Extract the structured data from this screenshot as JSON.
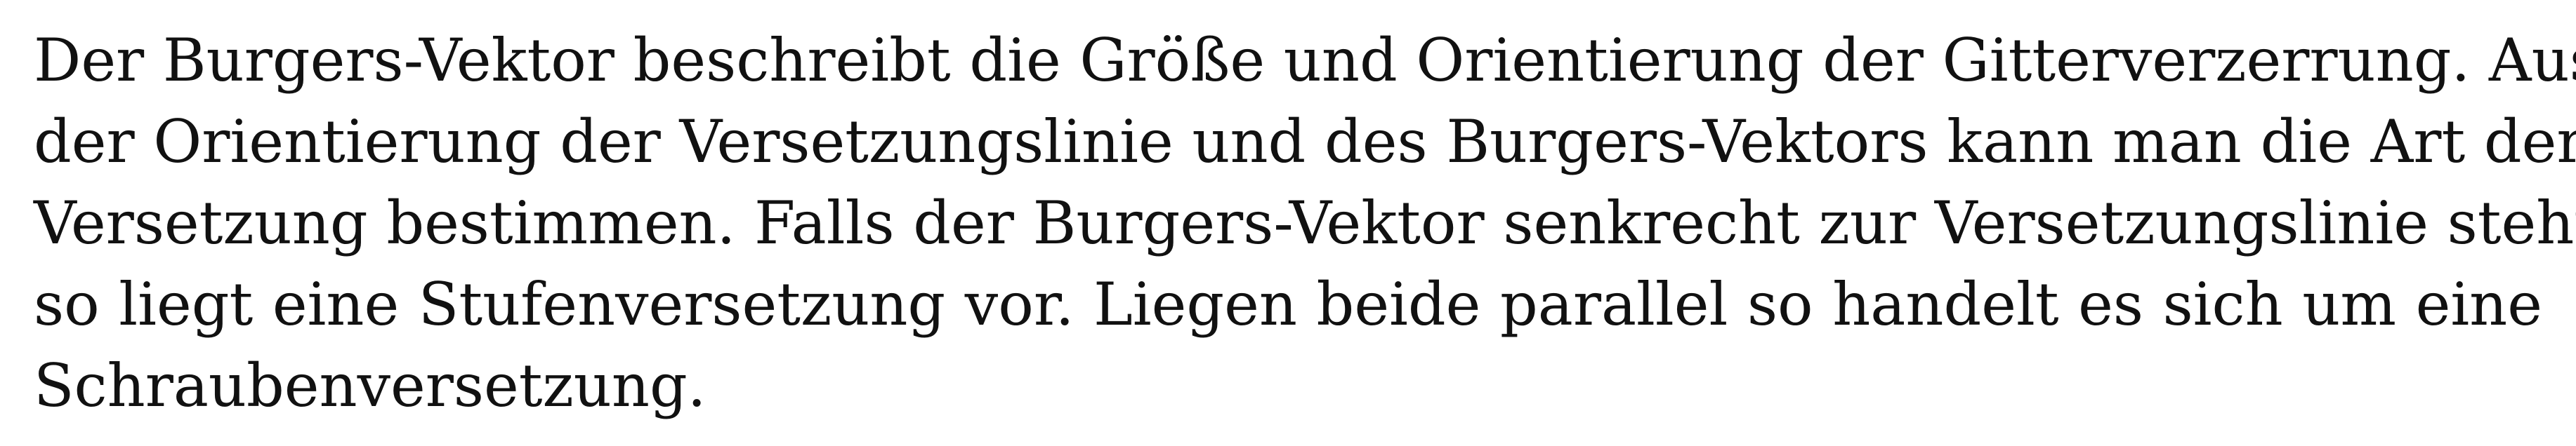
{
  "document": {
    "paragraph": {
      "lines": [
        "Der Burgers-Vektor beschreibt die Größe und Orientierung der Gitterverzerrung.  Aus",
        "der Orientierung der Versetzungslinie und des Burgers-Vektors kann man die Art der",
        "Versetzung bestimmen.  Falls der Burgers-Vektor senkrecht zur Versetzungslinie steht,",
        "so liegt eine Stufenversetzung vor.  Liegen beide parallel so handelt es sich um eine",
        "Schraubenversetzung."
      ]
    }
  }
}
